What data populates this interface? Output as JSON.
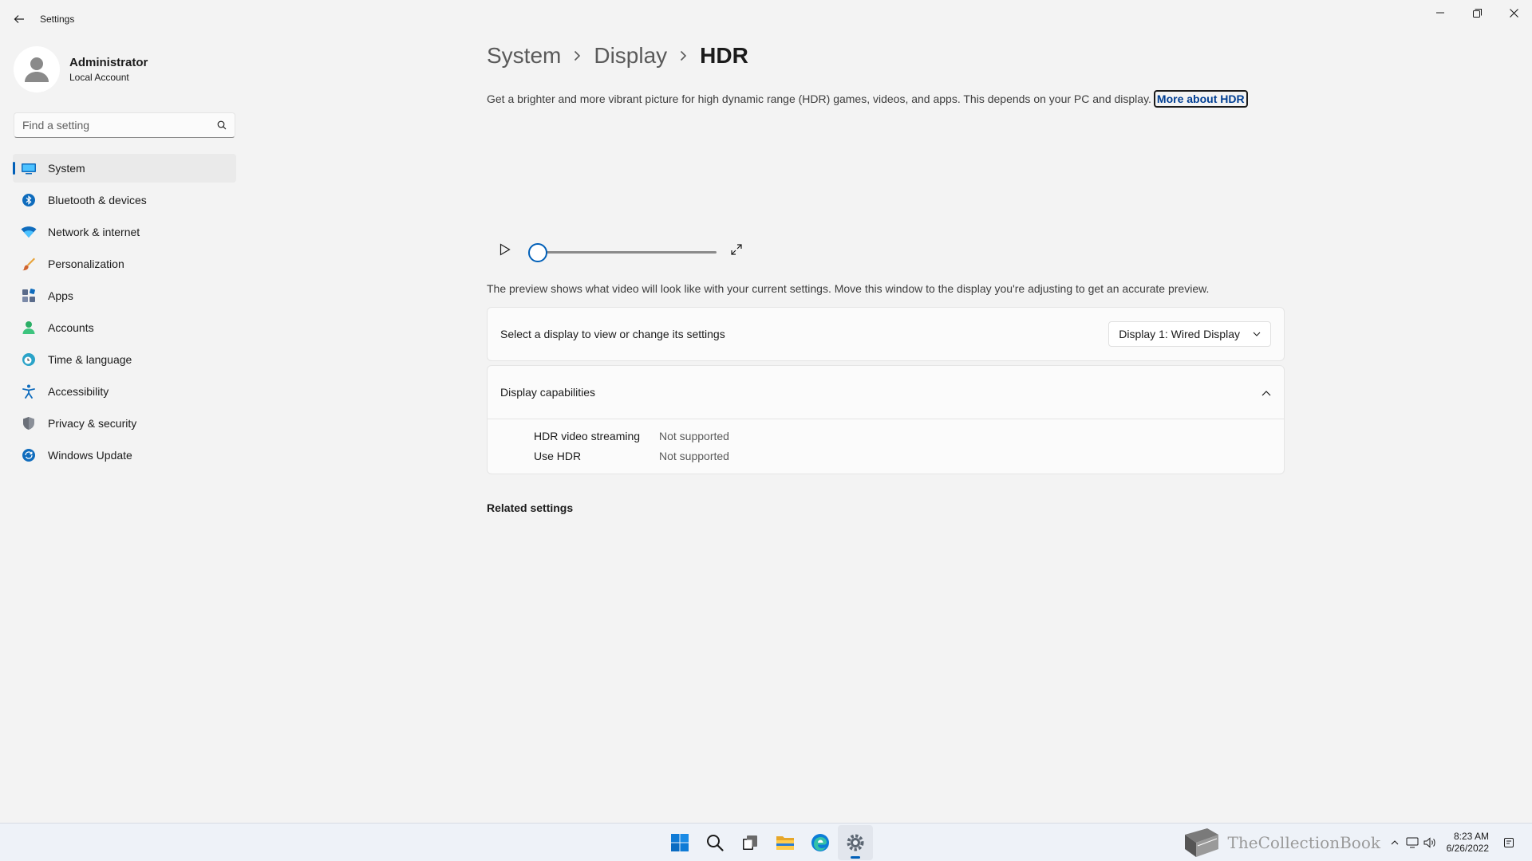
{
  "window": {
    "title": "Settings"
  },
  "user": {
    "name": "Administrator",
    "account_type": "Local Account"
  },
  "search": {
    "placeholder": "Find a setting"
  },
  "nav": {
    "items": [
      {
        "label": "System",
        "icon": "system-icon",
        "active": true
      },
      {
        "label": "Bluetooth & devices",
        "icon": "bluetooth-icon"
      },
      {
        "label": "Network & internet",
        "icon": "wifi-icon"
      },
      {
        "label": "Personalization",
        "icon": "brush-icon"
      },
      {
        "label": "Apps",
        "icon": "apps-icon"
      },
      {
        "label": "Accounts",
        "icon": "account-icon"
      },
      {
        "label": "Time & language",
        "icon": "globe-clock-icon"
      },
      {
        "label": "Accessibility",
        "icon": "accessibility-icon"
      },
      {
        "label": "Privacy & security",
        "icon": "shield-icon"
      },
      {
        "label": "Windows Update",
        "icon": "update-icon"
      }
    ]
  },
  "breadcrumb": {
    "items": [
      "System",
      "Display",
      "HDR"
    ]
  },
  "description": {
    "text": "Get a brighter and more vibrant picture for high dynamic range (HDR) games, videos, and apps. This depends on your PC and display.",
    "link": "More about HDR"
  },
  "player": {
    "progress": 0
  },
  "preview_note": "The preview shows what video will look like with your current settings. Move this window to the display you're adjusting to get an accurate preview.",
  "display_select": {
    "label": "Select a display to view or change its settings",
    "value": "Display 1: Wired Display"
  },
  "capabilities": {
    "title": "Display capabilities",
    "rows": [
      {
        "label": "HDR video streaming",
        "value": "Not supported"
      },
      {
        "label": "Use HDR",
        "value": "Not supported"
      }
    ]
  },
  "related_settings": "Related settings",
  "taskbar": {
    "apps": [
      "start-icon",
      "search-icon",
      "task-view-icon",
      "file-explorer-icon",
      "edge-icon",
      "settings-icon"
    ],
    "watermark": "TheCollectionBook",
    "time": "8:23 AM",
    "date": "6/26/2022"
  },
  "colors": {
    "accent": "#005fb8",
    "background": "#f3f3f3",
    "card": "#fbfbfb"
  }
}
